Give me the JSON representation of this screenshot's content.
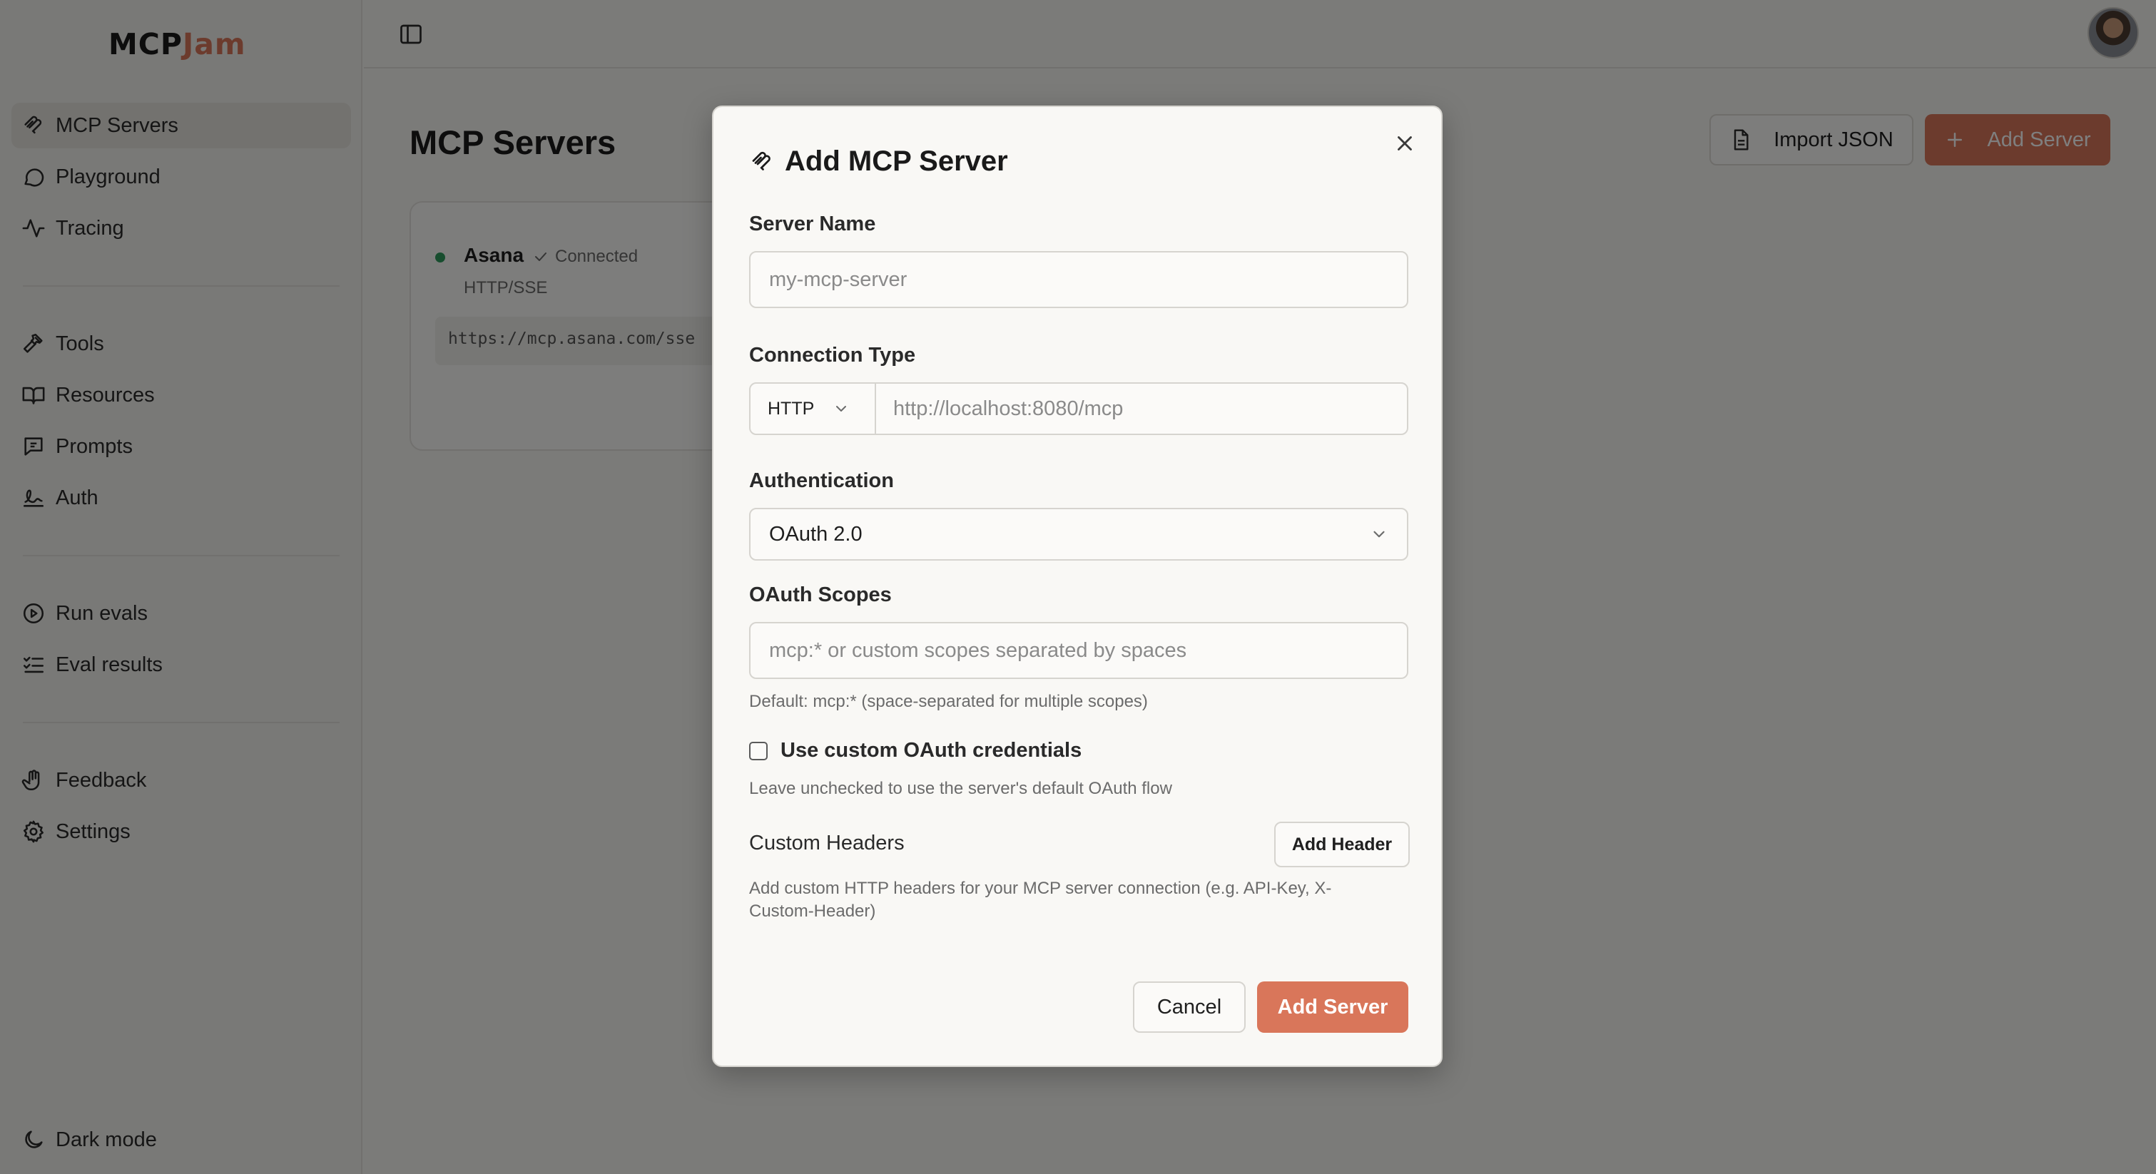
{
  "app": {
    "logo_part1": "MCP",
    "logo_part2": "Jam"
  },
  "sidebar": {
    "items": [
      {
        "label": "MCP Servers",
        "icon": "mcp-icon",
        "active": true
      },
      {
        "label": "Playground",
        "icon": "chat-bubble-icon"
      },
      {
        "label": "Tracing",
        "icon": "activity-icon"
      },
      {
        "label": "Tools",
        "icon": "hammer-icon"
      },
      {
        "label": "Resources",
        "icon": "book-icon"
      },
      {
        "label": "Prompts",
        "icon": "message-square-icon"
      },
      {
        "label": "Auth",
        "icon": "signature-icon"
      },
      {
        "label": "Run evals",
        "icon": "play-circle-icon"
      },
      {
        "label": "Eval results",
        "icon": "list-checks-icon"
      },
      {
        "label": "Feedback",
        "icon": "hand-icon"
      },
      {
        "label": "Settings",
        "icon": "gear-icon"
      }
    ],
    "dark_mode_label": "Dark mode"
  },
  "main": {
    "title": "MCP Servers",
    "import_label": "Import JSON",
    "add_server_label": "Add Server",
    "server_card": {
      "name": "Asana",
      "status": "Connected",
      "type": "HTTP/SSE",
      "url": "https://mcp.asana.com/sse",
      "status_color": "#2e9a5c"
    }
  },
  "modal": {
    "title": "Add MCP Server",
    "server_name_label": "Server Name",
    "server_name_placeholder": "my-mcp-server",
    "connection_type_label": "Connection Type",
    "connection_type_value": "HTTP",
    "connection_url_placeholder": "http://localhost:8080/mcp",
    "auth_label": "Authentication",
    "auth_value": "OAuth 2.0",
    "scopes_label": "OAuth Scopes",
    "scopes_placeholder": "mcp:* or custom scopes separated by spaces",
    "scopes_help": "Default: mcp:* (space-separated for multiple scopes)",
    "custom_creds_label": "Use custom OAuth credentials",
    "custom_creds_checked": false,
    "custom_creds_help": "Leave unchecked to use the server's default OAuth flow",
    "custom_headers_label": "Custom Headers",
    "add_header_label": "Add Header",
    "custom_headers_help": "Add custom HTTP headers for your MCP server connection (e.g. API-Key, X-Custom-Header)",
    "cancel_label": "Cancel",
    "submit_label": "Add Server"
  },
  "colors": {
    "accent": "#d9765a",
    "background": "#f7f6f3",
    "overlay": "rgba(0,0,0,0.5)"
  }
}
